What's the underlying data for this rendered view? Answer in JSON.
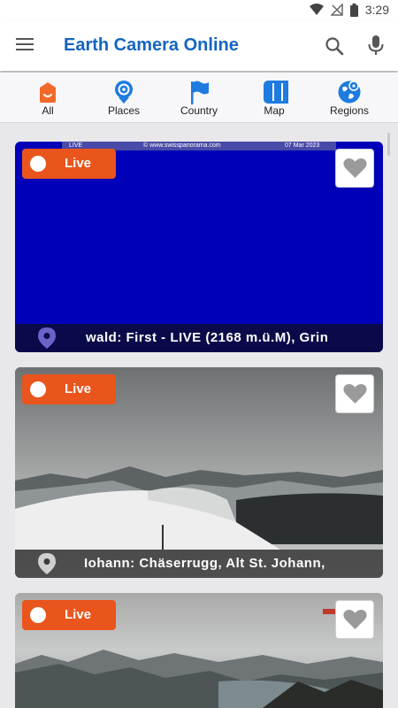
{
  "status_bar": {
    "time": "3:29"
  },
  "app_bar": {
    "title": "Earth Camera Online"
  },
  "tabs": [
    {
      "label": "All",
      "icon": "home-icon"
    },
    {
      "label": "Places",
      "icon": "place-icon"
    },
    {
      "label": "Country",
      "icon": "flag-icon"
    },
    {
      "label": "Map",
      "icon": "map-icon"
    },
    {
      "label": "Regions",
      "icon": "globe-icon"
    }
  ],
  "cameras": [
    {
      "live_label": "Live",
      "location": "wald: First - LIVE (2168 m.ü.M), Grin",
      "banner": {
        "left": "LIVE",
        "center": "© www.swisspanorama.com",
        "right": "07 Mar 2023"
      }
    },
    {
      "live_label": "Live",
      "location": "Iohann: Chäserrugg, Alt St. Johann,"
    },
    {
      "live_label": "Live"
    }
  ],
  "colors": {
    "accent": "#1565c0",
    "live_badge": "#e9551c",
    "tab_icon_blue": "#1e7be0",
    "tab_icon_orange": "#f26a2a"
  }
}
